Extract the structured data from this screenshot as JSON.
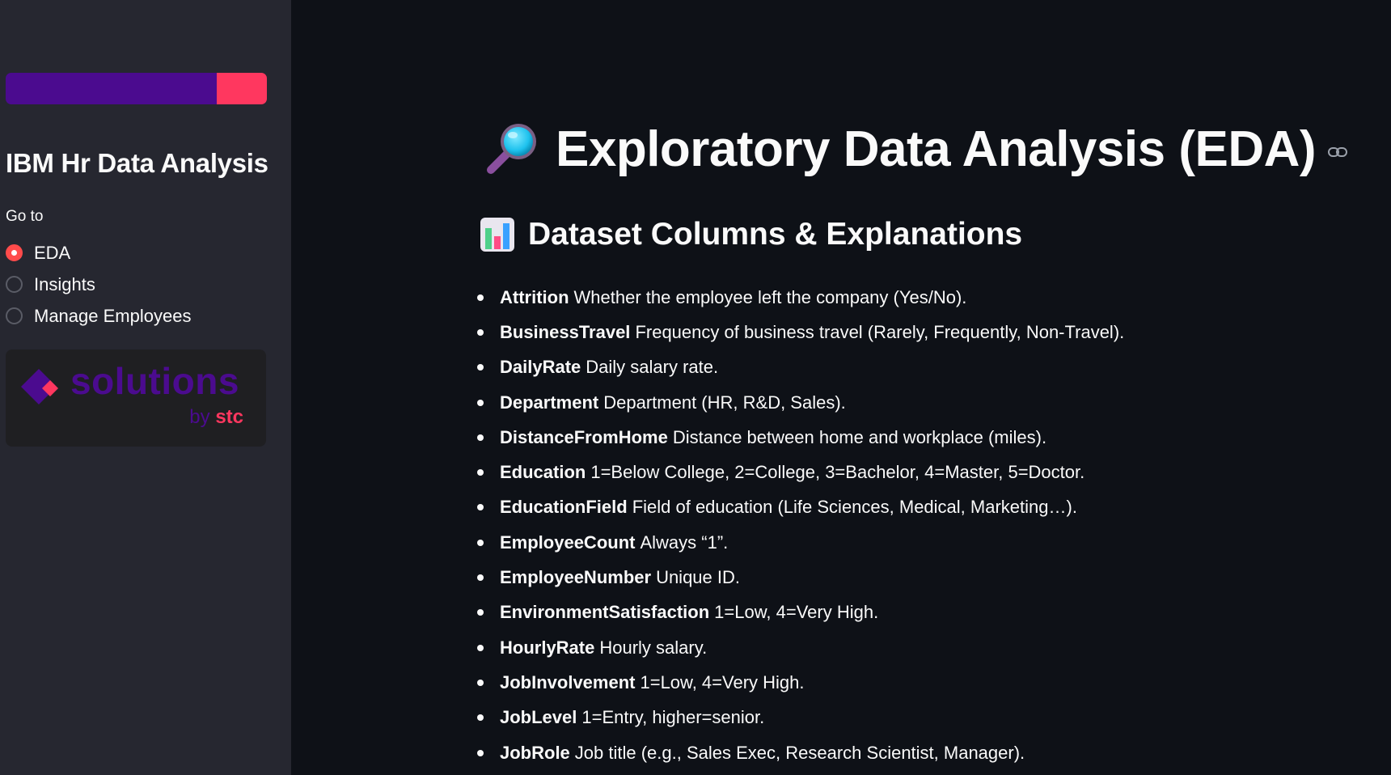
{
  "sidebar": {
    "title": "IBM Hr Data Analysis",
    "nav_label": "Go to",
    "nav_options": [
      {
        "label": "EDA",
        "selected": true
      },
      {
        "label": "Insights",
        "selected": false
      },
      {
        "label": "Manage Employees",
        "selected": false
      }
    ],
    "logo": {
      "word": "solutions",
      "by": "by",
      "brand": "stc"
    },
    "brand_colors": {
      "purple": "#4b0b8f",
      "pink": "#ff375f"
    }
  },
  "main": {
    "title_icon": "magnifying-glass-icon",
    "title": "Exploratory Data Analysis (EDA)",
    "section_icon": "bar-chart-icon",
    "section_title": "Dataset Columns & Explanations",
    "columns": [
      {
        "name": "Attrition",
        "desc": "Whether the employee left the company (Yes/No)."
      },
      {
        "name": "BusinessTravel",
        "desc": "Frequency of business travel (Rarely, Frequently, Non-Travel)."
      },
      {
        "name": "DailyRate",
        "desc": "Daily salary rate."
      },
      {
        "name": "Department",
        "desc": "Department (HR, R&D, Sales)."
      },
      {
        "name": "DistanceFromHome",
        "desc": "Distance between home and workplace (miles)."
      },
      {
        "name": "Education",
        "desc": "1=Below College, 2=College, 3=Bachelor, 4=Master, 5=Doctor."
      },
      {
        "name": "EducationField",
        "desc": "Field of education (Life Sciences, Medical, Marketing…)."
      },
      {
        "name": "EmployeeCount",
        "desc": "Always “1”."
      },
      {
        "name": "EmployeeNumber",
        "desc": "Unique ID."
      },
      {
        "name": "EnvironmentSatisfaction",
        "desc": "1=Low, 4=Very High."
      },
      {
        "name": "HourlyRate",
        "desc": "Hourly salary."
      },
      {
        "name": "JobInvolvement",
        "desc": "1=Low, 4=Very High."
      },
      {
        "name": "JobLevel",
        "desc": "1=Entry, higher=senior."
      },
      {
        "name": "JobRole",
        "desc": "Job title (e.g., Sales Exec, Research Scientist, Manager)."
      }
    ]
  },
  "colors": {
    "background": "#0e1117",
    "sidebar": "#262730",
    "accent": "#ff4b4b",
    "text": "#fafafa"
  }
}
